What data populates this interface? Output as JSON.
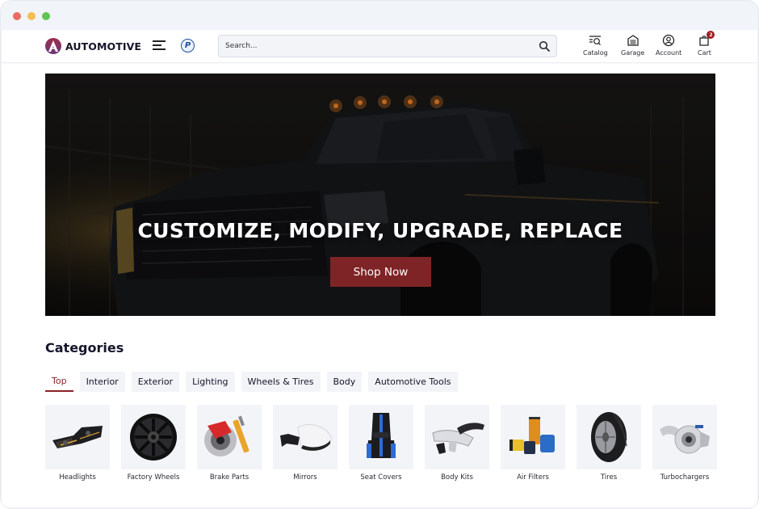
{
  "window": {
    "controls": [
      "close",
      "minimize",
      "maximize"
    ]
  },
  "header": {
    "logo_text": "AUTOMOTIVE",
    "logo_icon": "a-letter-logo",
    "menu_icon": "hamburger-menu-icon",
    "payment_icon": "paypal-icon",
    "search": {
      "placeholder": "Search...",
      "value": "",
      "icon": "search-icon"
    },
    "nav": [
      {
        "label": "Catalog",
        "icon": "catalog-search-icon"
      },
      {
        "label": "Garage",
        "icon": "garage-icon"
      },
      {
        "label": "Account",
        "icon": "account-icon"
      },
      {
        "label": "Cart",
        "icon": "cart-bag-icon",
        "badge": "2"
      }
    ]
  },
  "hero": {
    "title": "CUSTOMIZE, MODIFY, UPGRADE, REPLACE",
    "button_label": "Shop Now",
    "image": "black pickup truck in dark garage",
    "button_color": "#7e2426"
  },
  "categories": {
    "title": "Categories",
    "tabs": [
      {
        "label": "Top",
        "active": true
      },
      {
        "label": "Interior",
        "active": false
      },
      {
        "label": "Exterior",
        "active": false
      },
      {
        "label": "Lighting",
        "active": false
      },
      {
        "label": "Wheels & Tires",
        "active": false
      },
      {
        "label": "Body",
        "active": false
      },
      {
        "label": "Automotive Tools",
        "active": false
      }
    ],
    "items": [
      {
        "label": "Headlights",
        "image": "headlights"
      },
      {
        "label": "Factory Wheels",
        "image": "wheel"
      },
      {
        "label": "Brake Parts",
        "image": "brake-caliper"
      },
      {
        "label": "Mirrors",
        "image": "side-mirror"
      },
      {
        "label": "Seat Covers",
        "image": "seat-cover"
      },
      {
        "label": "Body Kits",
        "image": "body-kit"
      },
      {
        "label": "Air Filters",
        "image": "filters"
      },
      {
        "label": "Tires",
        "image": "tire"
      },
      {
        "label": "Turbochargers",
        "image": "turbocharger"
      }
    ]
  },
  "colors": {
    "accent": "#8a2328",
    "badge": "#9e1c22",
    "chip_bg": "#f2f4f8"
  }
}
